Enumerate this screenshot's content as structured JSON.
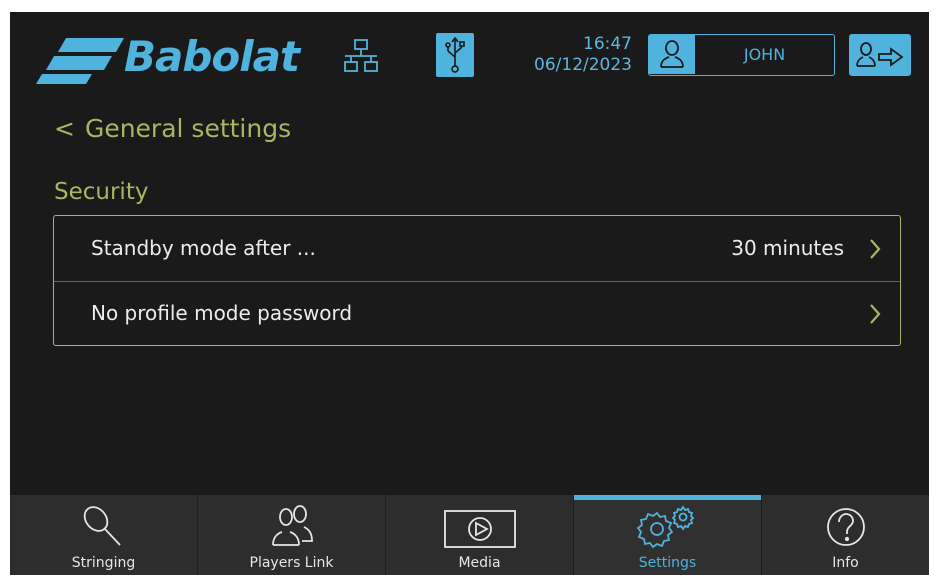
{
  "header": {
    "brand": "Babolat",
    "time": "16:47",
    "date": "06/12/2023",
    "user_name": "JOHN",
    "icons": {
      "network": "network-icon",
      "usb": "usb-icon",
      "user": "user-icon",
      "logout": "logout-icon"
    }
  },
  "page": {
    "back_chevron": "<",
    "title": "General settings"
  },
  "section": {
    "title": "Security"
  },
  "settings": [
    {
      "label": "Standby mode after ...",
      "value": "30 minutes"
    },
    {
      "label": "No profile mode password",
      "value": ""
    }
  ],
  "nav": {
    "items": [
      {
        "label": "Stringing",
        "icon": "racket-icon"
      },
      {
        "label": "Players Link",
        "icon": "players-icon"
      },
      {
        "label": "Media",
        "icon": "media-play-icon"
      },
      {
        "label": "Settings",
        "icon": "gears-icon",
        "active": true
      },
      {
        "label": "Info",
        "icon": "help-icon"
      }
    ]
  },
  "colors": {
    "accent_blue": "#4fb3de",
    "accent_olive": "#a6b75e",
    "background": "#1a1a1a",
    "nav_background": "#2d2d2d"
  }
}
